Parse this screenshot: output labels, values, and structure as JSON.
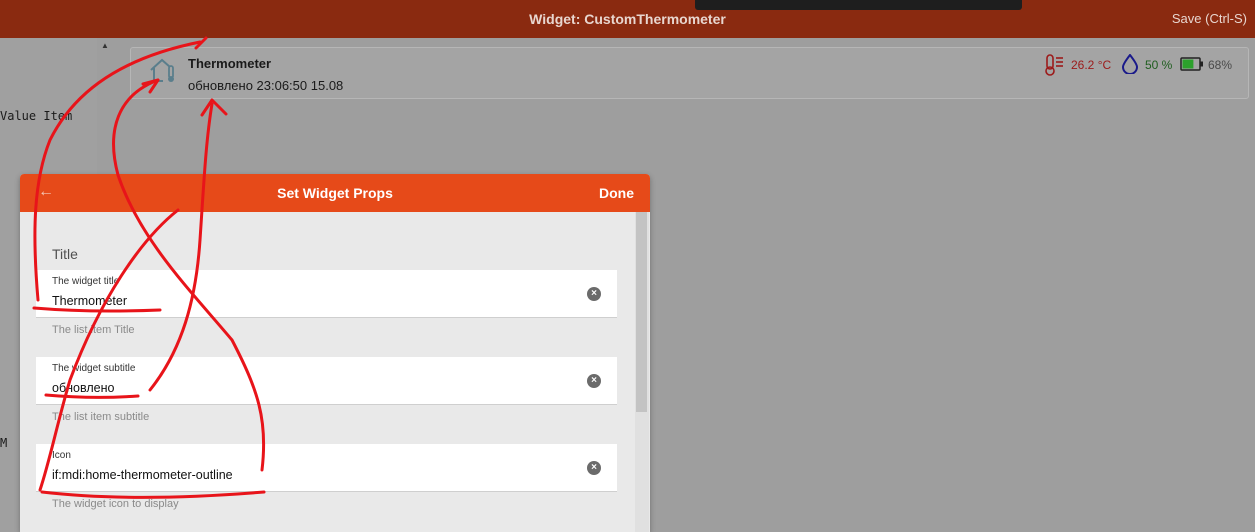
{
  "topbar": {
    "title": "Widget: CustomThermometer",
    "save_label": "Save (Ctrl-S)"
  },
  "code_pane": {
    "line1": "Value Item",
    "line2": "M"
  },
  "preview": {
    "icon": "home-thermometer-outline-icon",
    "title": "Thermometer",
    "subtitle": "обновлено 23:06:50 15.08",
    "temperature": "26.2 °C",
    "humidity": "50 %",
    "battery": "68%"
  },
  "dialog": {
    "back_icon": "arrow-left-icon",
    "title": "Set Widget Props",
    "done_label": "Done",
    "section_title": "Title",
    "fields": [
      {
        "label": "The widget title",
        "value": "Thermometer",
        "help": "The list item Title"
      },
      {
        "label": "The widget subtitle",
        "value": "обновлено",
        "help": "The list item subtitle"
      },
      {
        "label": "Icon",
        "value": "if:mdi:home-thermometer-outline",
        "help": "The widget icon to display"
      }
    ],
    "clear_glyph": "×"
  },
  "colors": {
    "topbar": "#8a2a10",
    "dialog_header": "#e64a19",
    "annotation": "#e8141a",
    "temperature": "#9c1a1a",
    "humidity": "#1f5e1f"
  }
}
